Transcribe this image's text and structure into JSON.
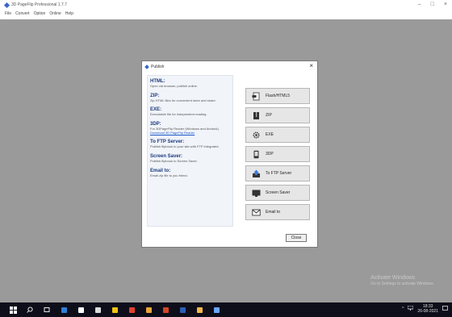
{
  "app": {
    "title": "3D PageFlip Professional 1.7.7",
    "menu": [
      "File",
      "Convert",
      "Option",
      "Online",
      "Help"
    ],
    "controls": {
      "minimize": "–",
      "maximize": "□",
      "close": "×"
    }
  },
  "dialog": {
    "title": "Publish",
    "close_x": "×",
    "items": [
      {
        "title": "HTML:",
        "desc": "Open via browser, publish online."
      },
      {
        "title": "ZIP:",
        "desc": "Zip HTML files for convenient store and share."
      },
      {
        "title": "EXE:",
        "desc": "Executable file for independent reading."
      },
      {
        "title": "3DP:",
        "desc": "For 3DPageFlip Reader (Windows and Android).",
        "link": "Download 3D PageFlip Reader"
      },
      {
        "title": "To FTP Server:",
        "desc": "Publish flipbook to your site with FTP integrated."
      },
      {
        "title": "Screen Saver:",
        "desc": "Publish flipbook to Screen Saver."
      },
      {
        "title": "Email to:",
        "desc": "Email zip file to you friend."
      }
    ],
    "buttons": {
      "html": "Flash/HTML5",
      "zip": "ZIP",
      "exe": "EXE",
      "p3dp": "3DP",
      "ftp": "To FTP Server",
      "screensaver": "Screen Saver",
      "email": "Email to"
    },
    "close_label": "Close"
  },
  "watermark": {
    "title": "Activate Windows",
    "subtitle": "Go to Settings to activate Windows."
  },
  "taskbar": {
    "time": "18:33",
    "date": "26-08-2021",
    "apps": [
      {
        "name": "edge",
        "color": "#2f7fd6"
      },
      {
        "name": "store",
        "color": "#ffffff"
      },
      {
        "name": "mail",
        "color": "#dcdcdc"
      },
      {
        "name": "files",
        "color": "#f1c40f"
      },
      {
        "name": "chrome",
        "color": "#e2412f"
      },
      {
        "name": "paint",
        "color": "#e8a53a"
      },
      {
        "name": "powerpoint",
        "color": "#d24726"
      },
      {
        "name": "word",
        "color": "#2b5fb4"
      },
      {
        "name": "notes",
        "color": "#f2b84b"
      },
      {
        "name": "pageflip",
        "color": "#6aa6ff"
      }
    ]
  },
  "colors": {
    "workspace": "#9a9a9a",
    "info_title": "#1d3a7d",
    "link": "#1f58c9",
    "taskbar": "#0e0e1a"
  }
}
